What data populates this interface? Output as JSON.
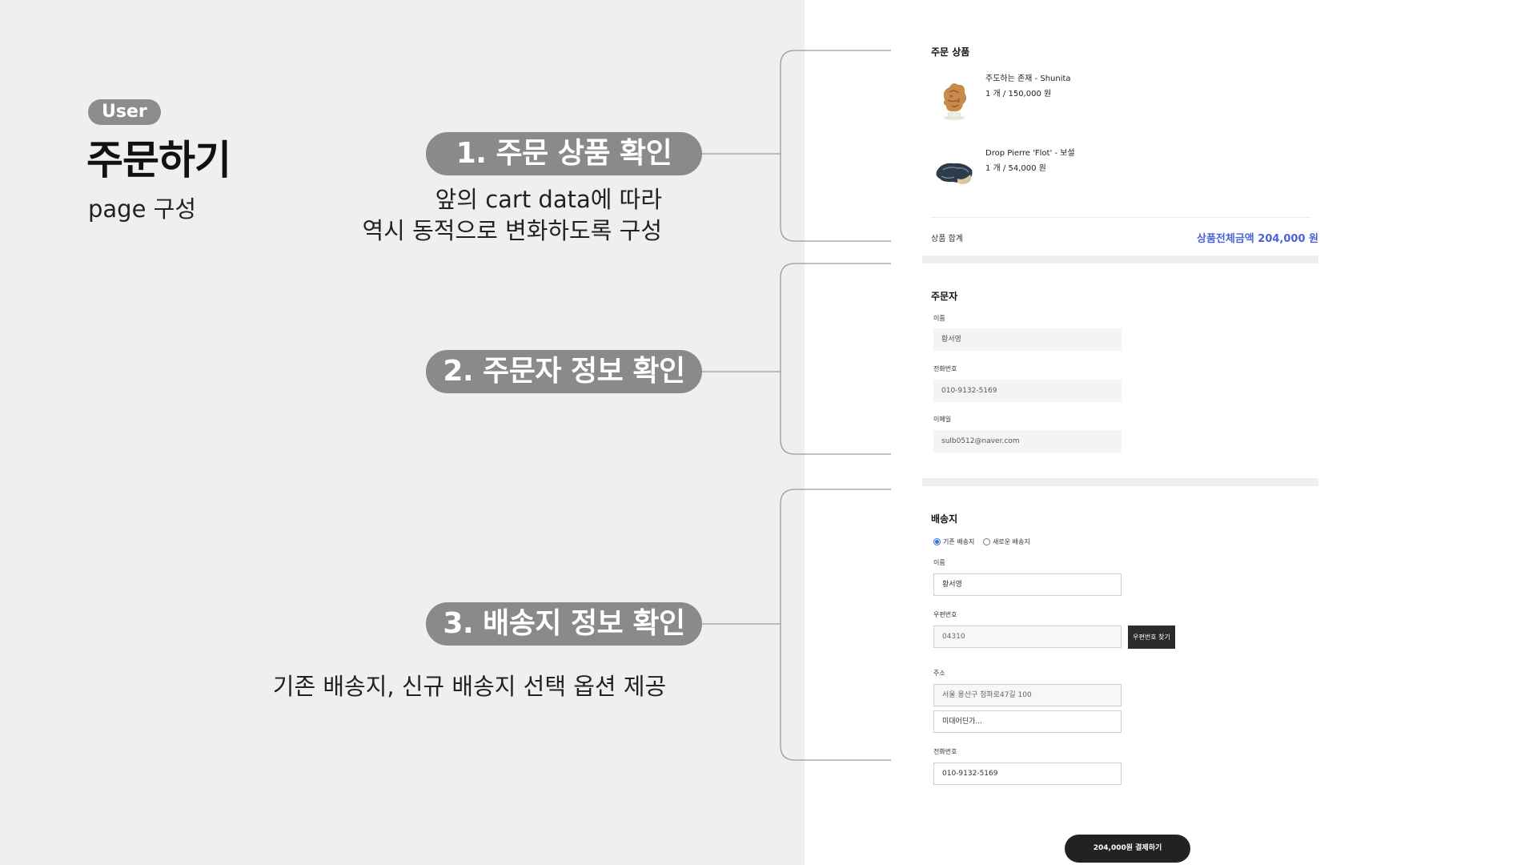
{
  "left": {
    "badge": "User",
    "title": "주문하기",
    "subtitle": "page 구성",
    "steps": [
      {
        "label": "1. 주문 상품  확인",
        "desc_lines": [
          "앞의 cart data에 따라",
          "역시 동적으로 변화하도록 구성"
        ]
      },
      {
        "label": "2. 주문자 정보 확인",
        "desc_lines": []
      },
      {
        "label": "3. 배송지 정보 확인",
        "desc_lines": [
          "기존 배송지, 신규 배송지 선택 옵션 제공"
        ]
      }
    ]
  },
  "order_items": {
    "title": "주문 상품",
    "items": [
      {
        "name": "주도하는 존재 - Shunita",
        "qty_price": "1 개 / 150,000 원",
        "thumb": "ceramic-figure-thumbnail"
      },
      {
        "name": "Drop Pierre 'Flot' - 보설",
        "qty_price": "1 개 / 54,000 원",
        "thumb": "stone-sculpture-thumbnail"
      }
    ],
    "total_label": "상품 합계",
    "total_value": "상품전체금액 204,000 원"
  },
  "orderer": {
    "title": "주문자",
    "fields": [
      {
        "label": "이름",
        "value": "황서영"
      },
      {
        "label": "전화번호",
        "value": "010-9132-5169"
      },
      {
        "label": "이메일",
        "value": "sulb0512@naver.com"
      }
    ]
  },
  "shipping": {
    "title": "배송지",
    "options": [
      "기존 배송지",
      "새로운 배송지"
    ],
    "selected_option": "기존 배송지",
    "name_label": "이름",
    "name_value": "황서영",
    "zip_label": "우편번호",
    "zip_value": "04310",
    "zip_button": "우편번호 찾기",
    "address_label": "주소",
    "address_1": "서울 용산구 청파로47길 100",
    "address_2": "미대어딘가...",
    "phone_label": "전화번호",
    "phone_value": "010-9132-5169"
  },
  "pay_button": "204,000원 결제하기",
  "colors": {
    "background": "#efefef",
    "pill": "#8a8a8a",
    "accent_blue": "#4a63d6",
    "button_dark": "#222222"
  }
}
